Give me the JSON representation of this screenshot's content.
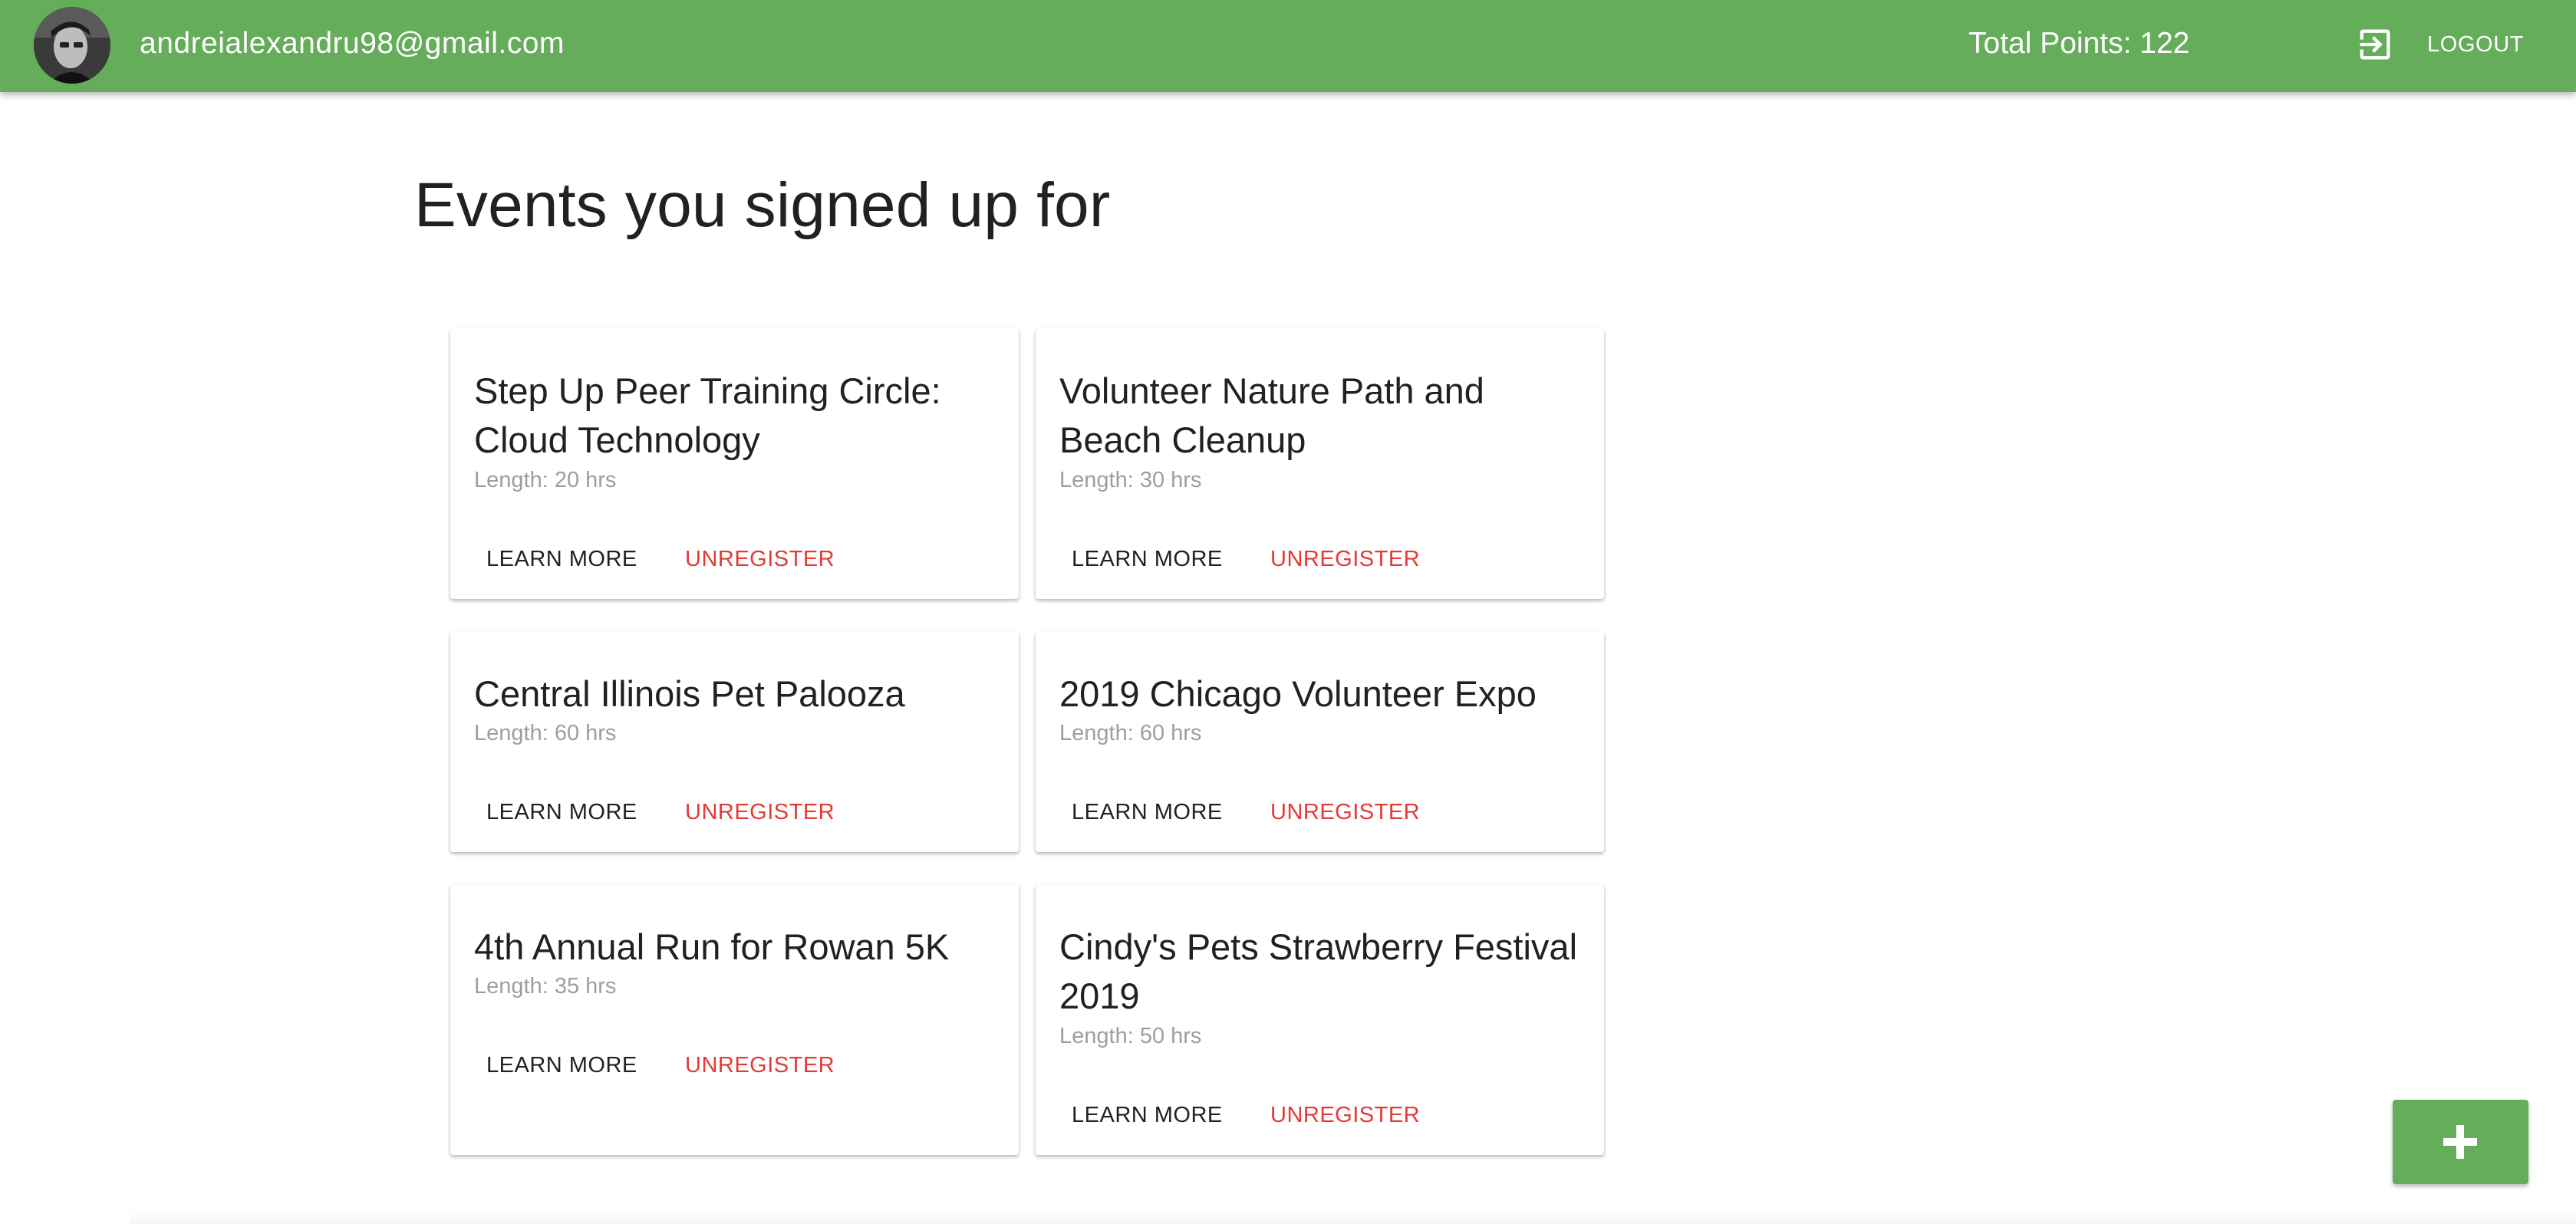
{
  "header": {
    "user_email": "andreialexandru98@gmail.com",
    "total_points": "Total Points: 122",
    "logout_label": "LOGOUT",
    "background_color": "#66ad5b",
    "icons": {
      "avatar": "user-avatar-photo",
      "logout": "logout-icon"
    }
  },
  "main": {
    "title": "Events you signed up for",
    "events": [
      {
        "title": "Step Up Peer Training Circle: Cloud Technology",
        "length": "Length: 20 hrs",
        "learn_more": "LEARN MORE",
        "unregister": "UNREGISTER"
      },
      {
        "title": "Volunteer Nature Path and Beach Cleanup",
        "length": "Length: 30 hrs",
        "learn_more": "LEARN MORE",
        "unregister": "UNREGISTER"
      },
      {
        "title": "Central Illinois Pet Palooza",
        "length": "Length: 60 hrs",
        "learn_more": "LEARN MORE",
        "unregister": "UNREGISTER"
      },
      {
        "title": "2019 Chicago Volunteer Expo",
        "length": "Length: 60 hrs",
        "learn_more": "LEARN MORE",
        "unregister": "UNREGISTER"
      },
      {
        "title": "4th Annual Run for Rowan 5K",
        "length": "Length: 35 hrs",
        "learn_more": "LEARN MORE",
        "unregister": "UNREGISTER"
      },
      {
        "title": "Cindy's Pets Strawberry Festival 2019",
        "length": "Length: 50 hrs",
        "learn_more": "LEARN MORE",
        "unregister": "UNREGISTER"
      }
    ]
  },
  "fab": {
    "icon": "plus-icon",
    "color": "#66ad5b"
  },
  "colors": {
    "unregister": "#e53935",
    "muted_text": "#9e9e9e"
  }
}
